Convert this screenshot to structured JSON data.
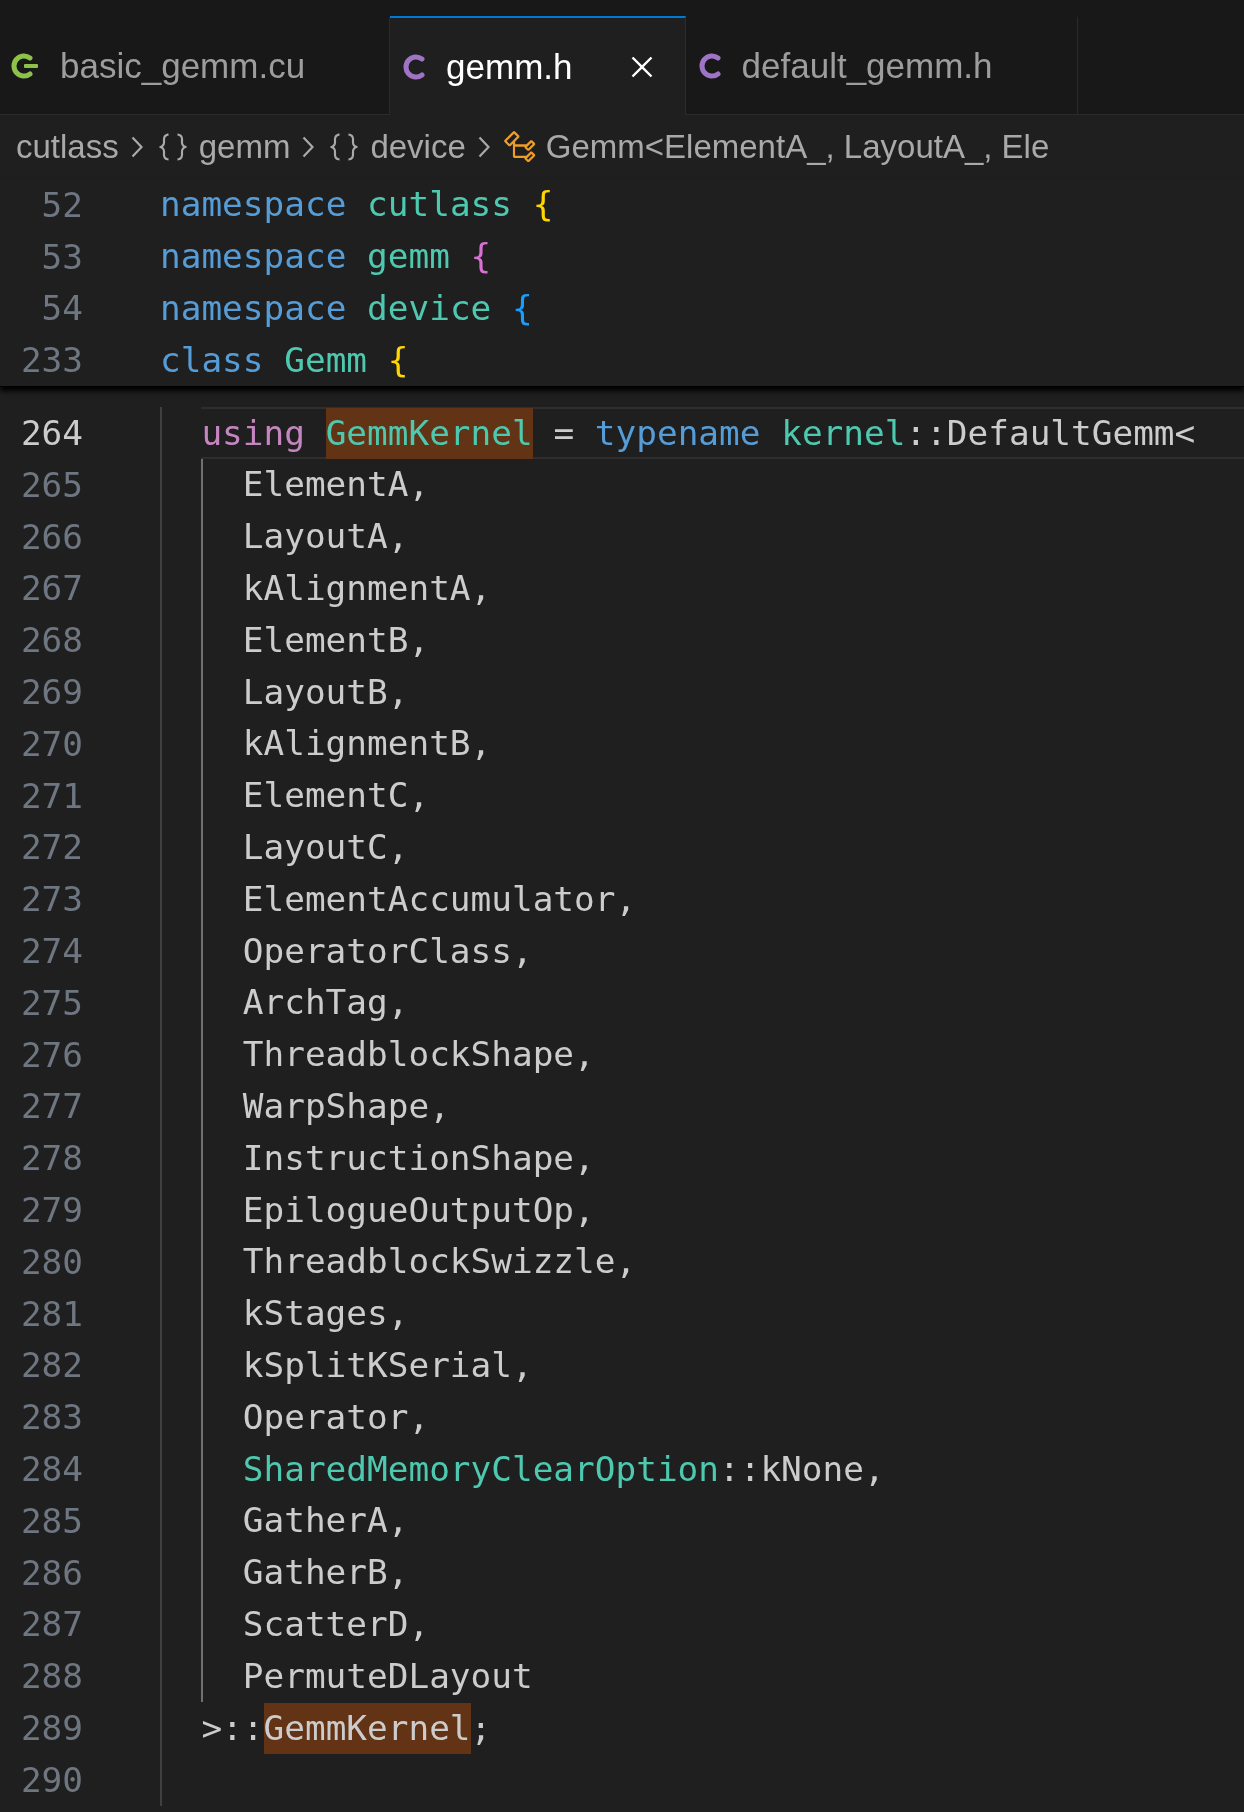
{
  "tabs": [
    {
      "label": "basic_gemm.cu",
      "kind": "cuda",
      "selected": false
    },
    {
      "label": "gemm.h",
      "kind": "c",
      "selected": true
    },
    {
      "label": "default_gemm.h",
      "kind": "c",
      "selected": false
    }
  ],
  "breadcrumb": [
    {
      "label": "cutlass",
      "kind": "plain"
    },
    {
      "label": "gemm",
      "kind": "namespace"
    },
    {
      "label": "device",
      "kind": "namespace"
    },
    {
      "label": "Gemm<ElementA_, LayoutA_, Ele",
      "kind": "class"
    }
  ],
  "sticky_lines": [
    {
      "number": "52",
      "tokens": [
        {
          "text": "namespace ",
          "kind": "keyword"
        },
        {
          "text": "cutlass ",
          "kind": "type"
        },
        {
          "text": "{",
          "kind": "bracket",
          "color": "#ffd700"
        }
      ]
    },
    {
      "number": "53",
      "tokens": [
        {
          "text": "namespace ",
          "kind": "keyword"
        },
        {
          "text": "gemm ",
          "kind": "type"
        },
        {
          "text": "{",
          "kind": "bracket",
          "color": "#da70d6"
        }
      ]
    },
    {
      "number": "54",
      "tokens": [
        {
          "text": "namespace ",
          "kind": "keyword"
        },
        {
          "text": "device ",
          "kind": "type"
        },
        {
          "text": "{",
          "kind": "bracket",
          "color": "#179fff"
        }
      ]
    },
    {
      "number": "233",
      "tokens": [
        {
          "text": "class ",
          "kind": "keyword"
        },
        {
          "text": "Gemm ",
          "kind": "type"
        },
        {
          "text": "{",
          "kind": "bracket",
          "color": "#ffd700"
        }
      ]
    }
  ],
  "lines": [
    {
      "number": "264",
      "current": true,
      "tokens": [
        {
          "text": "using ",
          "kind": "storage"
        },
        {
          "text": "GemmKernel",
          "kind": "type",
          "highlighted": true
        },
        {
          "text": " = ",
          "kind": "plain"
        },
        {
          "text": "typename ",
          "kind": "keyword"
        },
        {
          "text": "kernel",
          "kind": "type"
        },
        {
          "text": "::DefaultGemm<",
          "kind": "plain"
        }
      ],
      "children": [
        {
          "number": "265",
          "current": false,
          "tokens": [
            {
              "text": "ElementA,",
              "kind": "plain"
            }
          ]
        },
        {
          "number": "266",
          "current": false,
          "tokens": [
            {
              "text": "LayoutA,",
              "kind": "plain"
            }
          ]
        },
        {
          "number": "267",
          "current": false,
          "tokens": [
            {
              "text": "kAlignmentA,",
              "kind": "plain"
            }
          ]
        },
        {
          "number": "268",
          "current": false,
          "tokens": [
            {
              "text": "ElementB,",
              "kind": "plain"
            }
          ]
        },
        {
          "number": "269",
          "current": false,
          "tokens": [
            {
              "text": "LayoutB,",
              "kind": "plain"
            }
          ]
        },
        {
          "number": "270",
          "current": false,
          "tokens": [
            {
              "text": "kAlignmentB,",
              "kind": "plain"
            }
          ]
        },
        {
          "number": "271",
          "current": false,
          "tokens": [
            {
              "text": "ElementC,",
              "kind": "plain"
            }
          ]
        },
        {
          "number": "272",
          "current": false,
          "tokens": [
            {
              "text": "LayoutC,",
              "kind": "plain"
            }
          ]
        },
        {
          "number": "273",
          "current": false,
          "tokens": [
            {
              "text": "ElementAccumulator,",
              "kind": "plain"
            }
          ]
        },
        {
          "number": "274",
          "current": false,
          "tokens": [
            {
              "text": "OperatorClass,",
              "kind": "plain"
            }
          ]
        },
        {
          "number": "275",
          "current": false,
          "tokens": [
            {
              "text": "ArchTag,",
              "kind": "plain"
            }
          ]
        },
        {
          "number": "276",
          "current": false,
          "tokens": [
            {
              "text": "ThreadblockShape,",
              "kind": "plain"
            }
          ]
        },
        {
          "number": "277",
          "current": false,
          "tokens": [
            {
              "text": "WarpShape,",
              "kind": "plain"
            }
          ]
        },
        {
          "number": "278",
          "current": false,
          "tokens": [
            {
              "text": "InstructionShape,",
              "kind": "plain"
            }
          ]
        },
        {
          "number": "279",
          "current": false,
          "tokens": [
            {
              "text": "EpilogueOutputOp,",
              "kind": "plain"
            }
          ]
        },
        {
          "number": "280",
          "current": false,
          "tokens": [
            {
              "text": "ThreadblockSwizzle,",
              "kind": "plain"
            }
          ]
        },
        {
          "number": "281",
          "current": false,
          "tokens": [
            {
              "text": "kStages,",
              "kind": "plain"
            }
          ]
        },
        {
          "number": "282",
          "current": false,
          "tokens": [
            {
              "text": "kSplitKSerial,",
              "kind": "plain"
            }
          ]
        },
        {
          "number": "283",
          "current": false,
          "tokens": [
            {
              "text": "Operator,",
              "kind": "plain"
            }
          ]
        },
        {
          "number": "284",
          "current": false,
          "tokens": [
            {
              "text": "SharedMemoryClearOption",
              "kind": "type"
            },
            {
              "text": "::kNone,",
              "kind": "plain"
            }
          ]
        },
        {
          "number": "285",
          "current": false,
          "tokens": [
            {
              "text": "GatherA,",
              "kind": "plain"
            }
          ]
        },
        {
          "number": "286",
          "current": false,
          "tokens": [
            {
              "text": "GatherB,",
              "kind": "plain"
            }
          ]
        },
        {
          "number": "287",
          "current": false,
          "tokens": [
            {
              "text": "ScatterD,",
              "kind": "plain"
            }
          ]
        },
        {
          "number": "288",
          "current": false,
          "tokens": [
            {
              "text": "PermuteDLayout",
              "kind": "plain"
            }
          ]
        }
      ]
    },
    {
      "number": "289",
      "current": false,
      "tokens": [
        {
          "text": ">::",
          "kind": "plain"
        },
        {
          "text": "GemmKernel",
          "kind": "plain",
          "highlighted": true
        },
        {
          "text": ";",
          "kind": "plain"
        }
      ]
    },
    {
      "number": "290",
      "current": false
    }
  ]
}
